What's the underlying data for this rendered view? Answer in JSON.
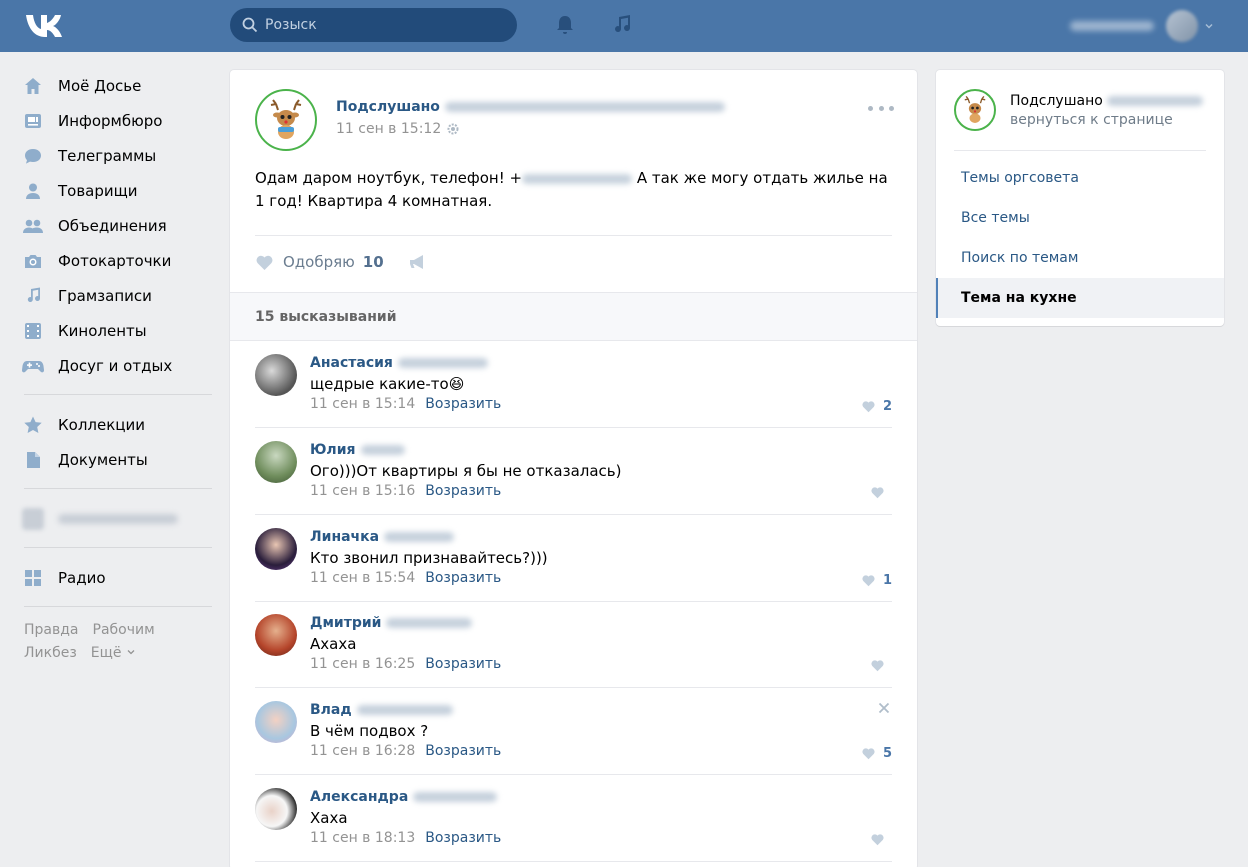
{
  "header": {
    "logo_icon": "vk-logo-icon",
    "search_placeholder": "Розыск",
    "notifications_icon": "bell-icon",
    "music_icon": "music-note-icon",
    "brand_color": "#4a76a8"
  },
  "sidebar": {
    "items": [
      {
        "label": "Моё Досье",
        "icon": "home-icon"
      },
      {
        "label": "Информбюро",
        "icon": "news-icon"
      },
      {
        "label": "Телеграммы",
        "icon": "messages-icon"
      },
      {
        "label": "Товарищи",
        "icon": "friend-icon"
      },
      {
        "label": "Объединения",
        "icon": "groups-icon"
      },
      {
        "label": "Фотокарточки",
        "icon": "camera-icon"
      },
      {
        "label": "Грамзаписи",
        "icon": "music-icon"
      },
      {
        "label": "Киноленты",
        "icon": "film-icon"
      },
      {
        "label": "Досуг и отдых",
        "icon": "gamepad-icon"
      }
    ],
    "items2": [
      {
        "label": "Коллекции",
        "icon": "star-icon"
      },
      {
        "label": "Документы",
        "icon": "document-icon"
      }
    ],
    "radio": {
      "label": "Радио",
      "icon": "apps-grid-icon"
    },
    "footer": [
      "Правда",
      "Рабочим",
      "Ликбез",
      "Ещё"
    ]
  },
  "post": {
    "author": "Подслушано",
    "date": "11 сен в 15:12",
    "text_before": "Одам даром ноутбук, телефон! +",
    "text_after": " А так же могу отдать жилье на 1 год! Квартира 4 комнатная.",
    "like_label": "Одобряю",
    "like_count": "10"
  },
  "comments_header": "15 высказываний",
  "comments": [
    {
      "author": "Анастасия",
      "text": "щедрые какие-то😆",
      "date": "11 сен в 15:14",
      "reply": "Возразить",
      "likes": "2"
    },
    {
      "author": "Юлия",
      "text": "Ого)))От квартиры я бы не отказалась)",
      "date": "11 сен в 15:16",
      "reply": "Возразить",
      "likes": ""
    },
    {
      "author": "Линачка",
      "text": "Кто звонил признавайтесь?)))",
      "date": "11 сен в 15:54",
      "reply": "Возразить",
      "likes": "1"
    },
    {
      "author": "Дмитрий",
      "text": "Ахаха",
      "date": "11 сен в 16:25",
      "reply": "Возразить",
      "likes": ""
    },
    {
      "author": "Влад",
      "text": "В чём подвох ?",
      "date": "11 сен в 16:28",
      "reply": "Возразить",
      "likes": "5"
    },
    {
      "author": "Александра",
      "text": "Хаха",
      "date": "11 сен в 18:13",
      "reply": "Возразить",
      "likes": ""
    }
  ],
  "right": {
    "title": "Подслушано",
    "subtitle": "вернуться к странице",
    "items": [
      "Темы оргсовета",
      "Все темы",
      "Поиск по темам",
      "Тема на кухне"
    ],
    "active_index": 3
  }
}
